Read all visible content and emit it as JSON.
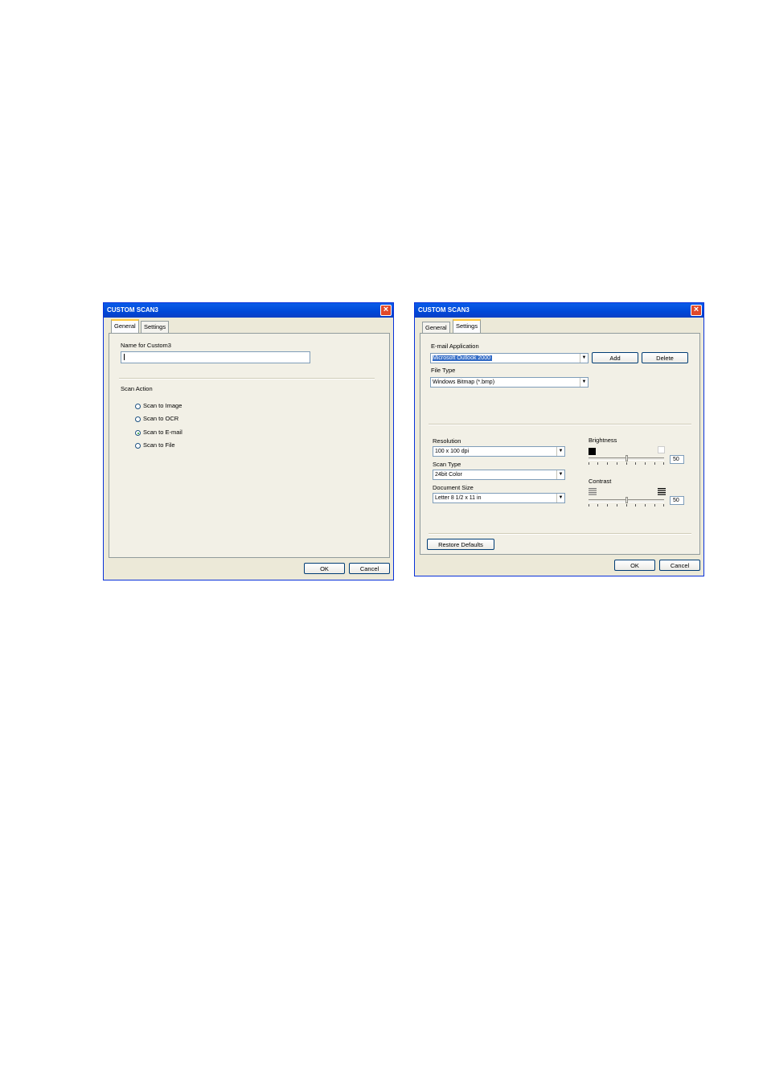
{
  "dialog1": {
    "title": "CUSTOM SCAN3",
    "tabs": [
      "General",
      "Settings"
    ],
    "name_label": "Name for Custom3",
    "name_value": "",
    "scan_action_label": "Scan Action",
    "options": [
      "Scan to Image",
      "Scan to OCR",
      "Scan to E-mail",
      "Scan to File"
    ],
    "selected_option": "Scan to E-mail",
    "ok": "OK",
    "cancel": "Cancel"
  },
  "dialog2": {
    "title": "CUSTOM SCAN3",
    "tabs": [
      "General",
      "Settings"
    ],
    "email_app_label": "E-mail Application",
    "email_app_value": "Microsoft Outlook 2000",
    "add": "Add",
    "delete": "Delete",
    "file_type_label": "File Type",
    "file_type_value": "Windows Bitmap (*.bmp)",
    "resolution_label": "Resolution",
    "resolution_value": "100 x 100 dpi",
    "scan_type_label": "Scan Type",
    "scan_type_value": "24bit Color",
    "doc_size_label": "Document Size",
    "doc_size_value": "Letter 8 1/2 x 11 in",
    "brightness_label": "Brightness",
    "brightness_value": "50",
    "contrast_label": "Contrast",
    "contrast_value": "50",
    "restore": "Restore Defaults",
    "ok": "OK",
    "cancel": "Cancel"
  },
  "icons": {
    "close": "close-icon",
    "dropdown": "chevron-down-icon",
    "brightness_low": "dark-square-icon",
    "brightness_high": "light-square-icon",
    "contrast_low": "low-contrast-icon",
    "contrast_high": "high-contrast-icon"
  }
}
